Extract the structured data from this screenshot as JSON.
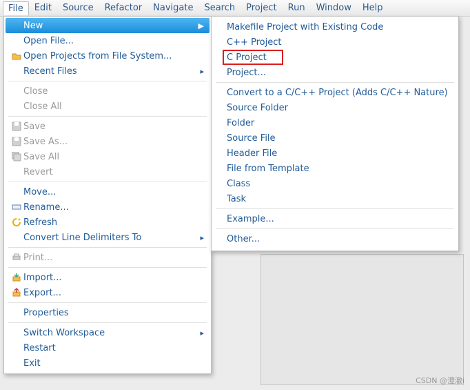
{
  "menubar": [
    "File",
    "Edit",
    "Source",
    "Refactor",
    "Navigate",
    "Search",
    "Project",
    "Run",
    "Window",
    "Help"
  ],
  "file_menu": {
    "new": "New",
    "open_file": "Open File...",
    "open_projects": "Open Projects from File System...",
    "recent_files": "Recent Files",
    "close": "Close",
    "close_all": "Close All",
    "save": "Save",
    "save_as": "Save As...",
    "save_all": "Save All",
    "revert": "Revert",
    "move": "Move...",
    "rename": "Rename...",
    "refresh": "Refresh",
    "convert_delim": "Convert Line Delimiters To",
    "print": "Print...",
    "import": "Import...",
    "export": "Export...",
    "properties": "Properties",
    "switch_workspace": "Switch Workspace",
    "restart": "Restart",
    "exit": "Exit"
  },
  "new_submenu": {
    "makefile_project": "Makefile Project with Existing Code",
    "cpp_project": "C++ Project",
    "c_project": "C Project",
    "project": "Project...",
    "convert_c": "Convert to a C/C++ Project (Adds C/C++ Nature)",
    "source_folder": "Source Folder",
    "folder": "Folder",
    "source_file": "Source File",
    "header_file": "Header File",
    "file_template": "File from Template",
    "class": "Class",
    "task": "Task",
    "example": "Example...",
    "other": "Other..."
  },
  "watermark": "CSDN @澄澈i"
}
